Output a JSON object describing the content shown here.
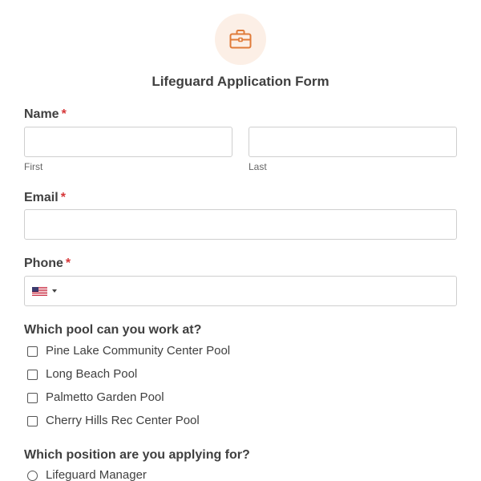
{
  "form": {
    "title": "Lifeguard Application Form",
    "icon": "briefcase-icon",
    "accent_color": "#e07b39",
    "required_marker": "*"
  },
  "fields": {
    "name": {
      "label": "Name",
      "first_sublabel": "First",
      "last_sublabel": "Last",
      "first_value": "",
      "last_value": ""
    },
    "email": {
      "label": "Email",
      "value": ""
    },
    "phone": {
      "label": "Phone",
      "country_flag": "us-flag-icon",
      "value": ""
    },
    "pool": {
      "label": "Which pool can you work at?",
      "options": [
        "Pine Lake Community Center Pool",
        "Long Beach Pool",
        "Palmetto Garden Pool",
        "Cherry Hills Rec Center Pool"
      ]
    },
    "position": {
      "label": "Which position are you applying for?",
      "options": [
        "Lifeguard Manager"
      ]
    }
  }
}
